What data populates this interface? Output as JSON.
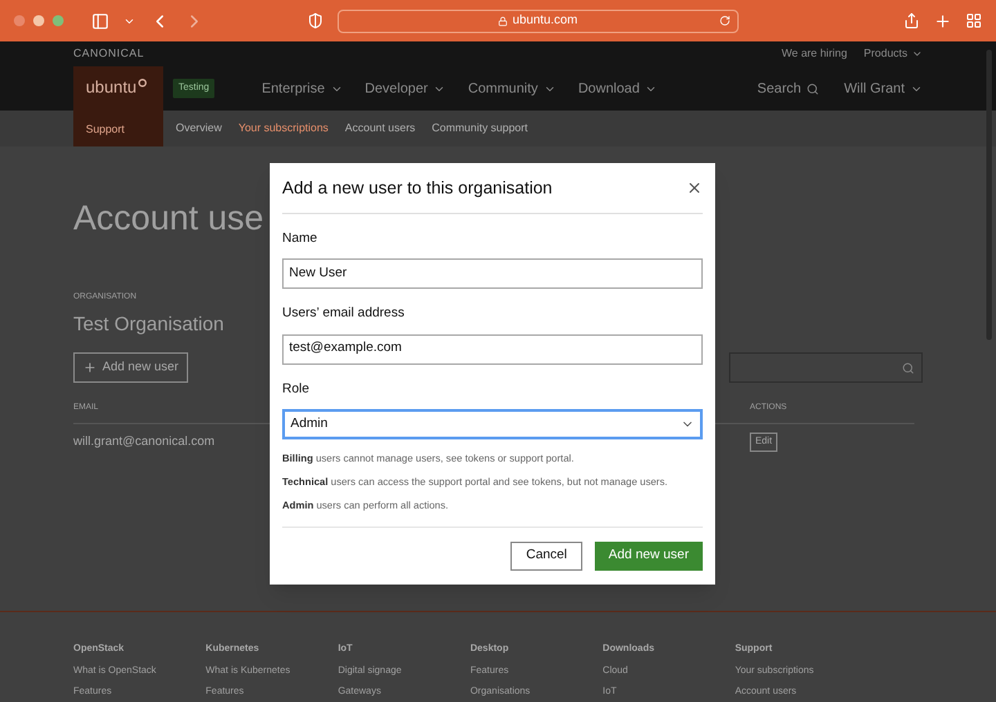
{
  "browser": {
    "url": "ubuntu.com"
  },
  "header": {
    "brand": "CANONICAL",
    "top_links": [
      {
        "label": "We are hiring",
        "dropdown": false
      },
      {
        "label": "Products",
        "dropdown": true
      }
    ],
    "logo": "ubuntu",
    "badge": "Testing",
    "nav": [
      "Enterprise",
      "Developer",
      "Community",
      "Download"
    ],
    "search": "Search",
    "user": "Will Grant"
  },
  "subnav": {
    "section": "Support",
    "items": [
      {
        "label": "Overview",
        "selected": false
      },
      {
        "label": "Your subscriptions",
        "selected": true
      },
      {
        "label": "Account users",
        "selected": false
      },
      {
        "label": "Community support",
        "selected": false
      }
    ]
  },
  "page": {
    "title": "Account use",
    "org_label": "ORGANISATION",
    "org_name": "Test Organisation",
    "add_button": "Add new user",
    "table": {
      "columns": [
        "EMAIL",
        "ACTIONS"
      ],
      "rows": [
        {
          "email": "will.grant@canonical.com",
          "action": "Edit"
        }
      ]
    }
  },
  "modal": {
    "title": "Add a new user to this organisation",
    "fields": [
      {
        "kind": "text",
        "label": "Name",
        "value": "New User",
        "focused": false
      },
      {
        "kind": "text",
        "label": "Users’ email address",
        "value": "test@example.com",
        "focused": false
      },
      {
        "kind": "select",
        "label": "Role",
        "value": "Admin",
        "focused": true
      }
    ],
    "notes": [
      "**Billing** users cannot manage users, see tokens or support portal.",
      "**Technical** users can access the support portal and see tokens, but not manage users.",
      "**Admin** users can perform all actions."
    ],
    "buttons": [
      {
        "label": "Cancel",
        "kind": "secondary"
      },
      {
        "label": "Add new user",
        "kind": "primary"
      }
    ]
  },
  "footer": [
    {
      "heading": "OpenStack",
      "links": [
        "What is OpenStack",
        "Features"
      ]
    },
    {
      "heading": "Kubernetes",
      "links": [
        "What is Kubernetes",
        "Features"
      ]
    },
    {
      "heading": "IoT",
      "links": [
        "Digital signage",
        "Gateways"
      ]
    },
    {
      "heading": "Desktop",
      "links": [
        "Features",
        "Organisations"
      ]
    },
    {
      "heading": "Downloads",
      "links": [
        "Cloud",
        "IoT"
      ]
    },
    {
      "heading": "Support",
      "links": [
        "Your subscriptions",
        "Account users"
      ]
    }
  ]
}
